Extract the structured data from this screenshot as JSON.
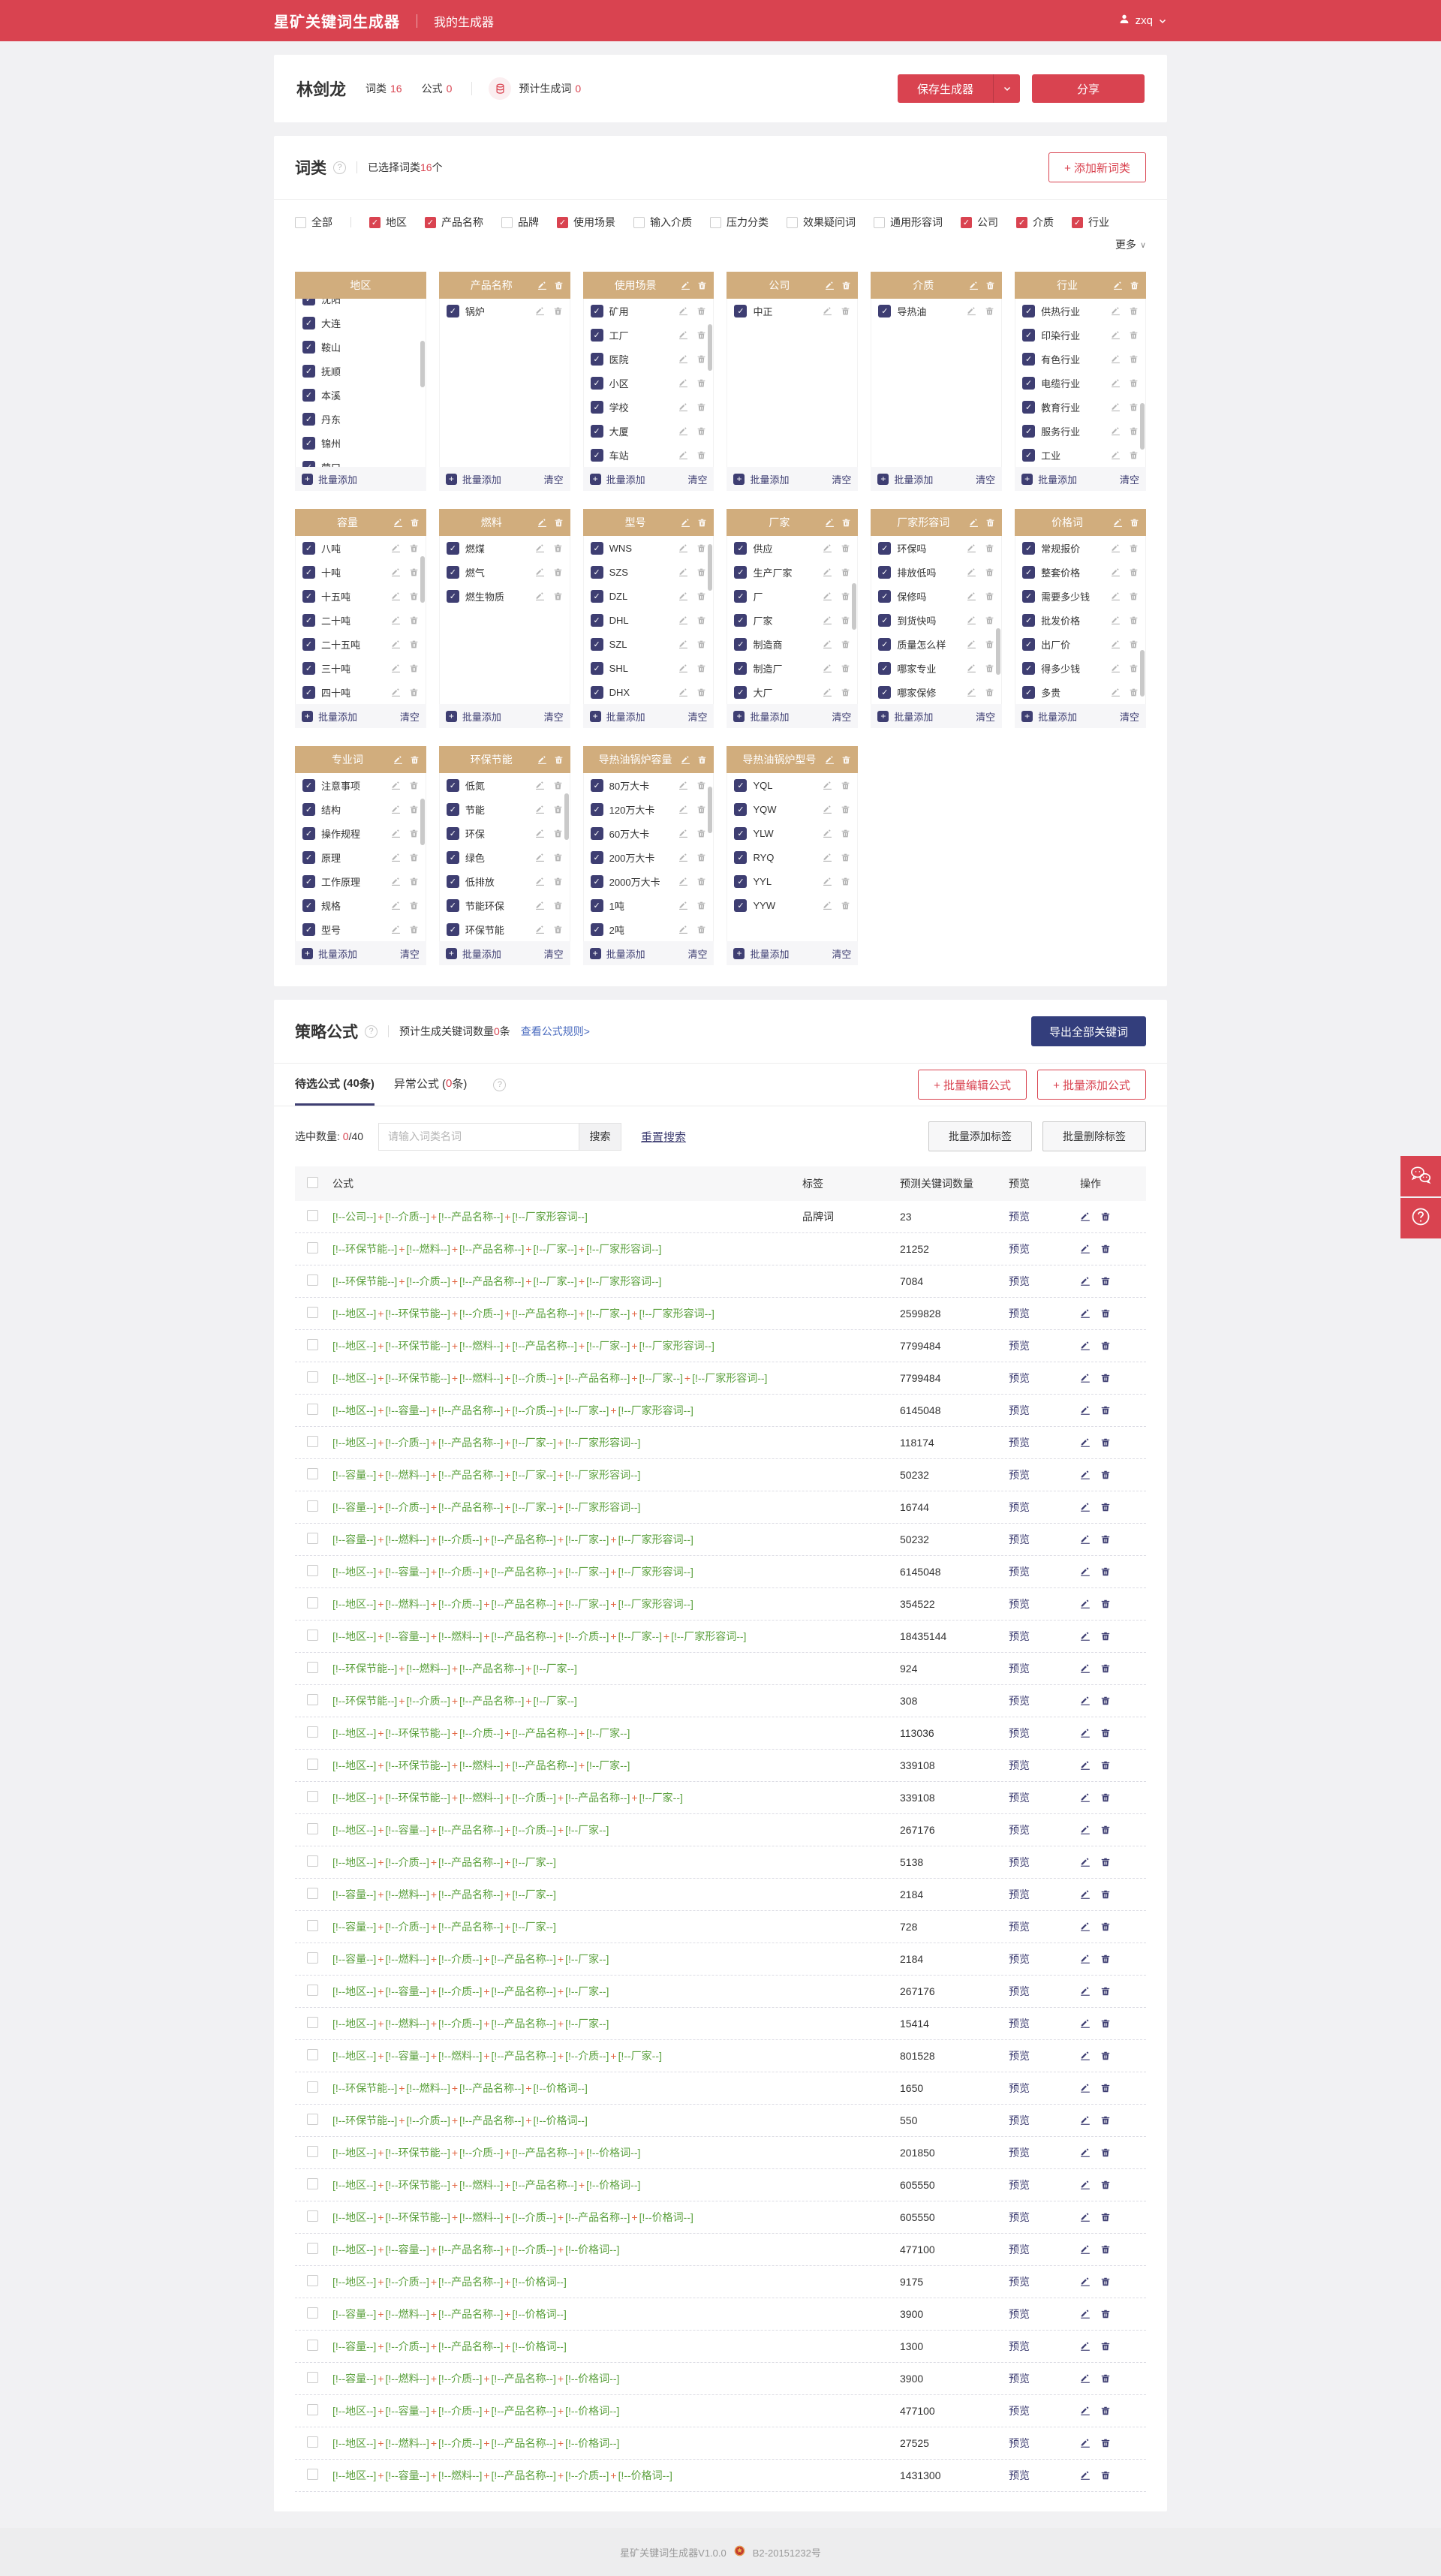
{
  "header": {
    "brand": "星矿关键词生成器",
    "nav": "我的生成器",
    "user": "zxq"
  },
  "summary": {
    "name": "林剑龙",
    "stat1_label": "词类",
    "stat1_value": "16",
    "stat2_label": "公式",
    "stat2_value": "0",
    "gen_label": "预计生成词",
    "gen_value": "0",
    "save_label": "保存生成器",
    "share_label": "分享"
  },
  "wordclass": {
    "title": "词类",
    "help": "?",
    "selected_pre": "已选择词类",
    "selected_num": "16",
    "selected_suf": "个",
    "add_new": "+ 添加新词类",
    "more": "更多",
    "filters": [
      {
        "label": "全部",
        "checked": false
      },
      {
        "label": "地区",
        "checked": true
      },
      {
        "label": "产品名称",
        "checked": true
      },
      {
        "label": "品牌",
        "checked": false
      },
      {
        "label": "使用场景",
        "checked": true
      },
      {
        "label": "输入介质",
        "checked": false
      },
      {
        "label": "压力分类",
        "checked": false
      },
      {
        "label": "效果疑问词",
        "checked": false
      },
      {
        "label": "通用形容词",
        "checked": false
      },
      {
        "label": "公司",
        "checked": true
      },
      {
        "label": "介质",
        "checked": true
      },
      {
        "label": "行业",
        "checked": true
      }
    ],
    "batch_add": "批量添加",
    "clear": "清空",
    "cards": [
      {
        "title": "地区",
        "items": [
          "沈阳",
          "大连",
          "鞍山",
          "抚顺",
          "本溪",
          "丹东",
          "锦州",
          "营口"
        ],
        "header_icons": false,
        "item_icons": false,
        "clear": false,
        "scrollbar": true,
        "thumb_top": 0.25,
        "scrolled": true
      },
      {
        "title": "产品名称",
        "items": [
          "锅炉"
        ],
        "header_icons": true,
        "item_icons": true,
        "clear": true,
        "scrollbar": false
      },
      {
        "title": "使用场景",
        "items": [
          "矿用",
          "工厂",
          "医院",
          "小区",
          "学校",
          "大厦",
          "车站"
        ],
        "header_icons": true,
        "item_icons": true,
        "clear": true,
        "scrollbar": true,
        "thumb_top": 0.15
      },
      {
        "title": "公司",
        "items": [
          "中正"
        ],
        "header_icons": true,
        "item_icons": true,
        "clear": true,
        "scrollbar": false
      },
      {
        "title": "介质",
        "items": [
          "导热油"
        ],
        "header_icons": true,
        "item_icons": true,
        "clear": true,
        "scrollbar": false
      },
      {
        "title": "行业",
        "items": [
          "供热行业",
          "印染行业",
          "有色行业",
          "电缆行业",
          "教育行业",
          "服务行业",
          "工业"
        ],
        "header_icons": true,
        "item_icons": true,
        "clear": true,
        "scrollbar": true,
        "thumb_top": 0.62
      },
      {
        "title": "容量",
        "items": [
          "八吨",
          "十吨",
          "十五吨",
          "二十吨",
          "二十五吨",
          "三十吨",
          "四十吨"
        ],
        "header_icons": true,
        "item_icons": true,
        "clear": true,
        "scrollbar": true,
        "thumb_top": 0.12
      },
      {
        "title": "燃料",
        "items": [
          "燃煤",
          "燃气",
          "燃生物质"
        ],
        "header_icons": true,
        "item_icons": true,
        "clear": true,
        "scrollbar": false
      },
      {
        "title": "型号",
        "items": [
          "WNS",
          "SZS",
          "DZL",
          "DHL",
          "SZL",
          "SHL",
          "DHX"
        ],
        "header_icons": true,
        "item_icons": true,
        "clear": true,
        "scrollbar": true,
        "thumb_top": 0.05
      },
      {
        "title": "厂家",
        "items": [
          "供应",
          "生产厂家",
          "厂",
          "厂家",
          "制造商",
          "制造厂",
          "大厂"
        ],
        "header_icons": true,
        "item_icons": true,
        "clear": true,
        "scrollbar": true,
        "thumb_top": 0.28
      },
      {
        "title": "厂家形容词",
        "items": [
          "环保吗",
          "排放低吗",
          "保修吗",
          "到货快吗",
          "质量怎么样",
          "哪家专业",
          "哪家保修"
        ],
        "header_icons": true,
        "item_icons": true,
        "clear": true,
        "scrollbar": true,
        "thumb_top": 0.55
      },
      {
        "title": "价格词",
        "items": [
          "常规报价",
          "整套价格",
          "需要多少钱",
          "批发价格",
          "出厂价",
          "得多少钱",
          "多贵"
        ],
        "header_icons": true,
        "item_icons": true,
        "clear": true,
        "scrollbar": true,
        "thumb_top": 0.68
      },
      {
        "title": "专业词",
        "items": [
          "注意事项",
          "结构",
          "操作规程",
          "原理",
          "工作原理",
          "规格",
          "型号"
        ],
        "header_icons": true,
        "item_icons": true,
        "clear": true,
        "scrollbar": true,
        "thumb_top": 0.15
      },
      {
        "title": "环保节能",
        "items": [
          "低氮",
          "节能",
          "环保",
          "绿色",
          "低排放",
          "节能环保",
          "环保节能"
        ],
        "header_icons": true,
        "item_icons": true,
        "clear": true,
        "scrollbar": true,
        "thumb_top": 0.12
      },
      {
        "title": "导热油锅炉容量",
        "items": [
          "80万大卡",
          "120万大卡",
          "60万大卡",
          "200万大卡",
          "2000万大卡",
          "1吨",
          "2吨"
        ],
        "header_icons": true,
        "item_icons": true,
        "clear": true,
        "scrollbar": true,
        "thumb_top": 0.08
      },
      {
        "title": "导热油锅炉型号",
        "items": [
          "YQL",
          "YQW",
          "YLW",
          "RYQ",
          "YYL",
          "YYW"
        ],
        "header_icons": true,
        "item_icons": true,
        "clear": true,
        "scrollbar": false
      }
    ]
  },
  "formula": {
    "title": "策略公式",
    "count_pre": "预计生成关键词数量",
    "count_num": "0",
    "count_suf": "条",
    "rules_link": "查看公式规则>",
    "export_btn": "导出全部关键词",
    "tab1_pre": "待选公式 (",
    "tab1_num": "40",
    "tab1_suf": "条)",
    "tab2_pre": "异常公式 (",
    "tab2_num": "0",
    "tab2_suf": "条)",
    "batch_edit": "+ 批量编辑公式",
    "batch_add": "+ 批量添加公式",
    "selected_label": "选中数量:",
    "selected_num": "0",
    "selected_total": "/40",
    "search_placeholder": "请输入词类名词",
    "search_btn": "搜索",
    "reset_btn": "重置搜索",
    "tag_add_btn": "批量添加标签",
    "tag_del_btn": "批量删除标签",
    "col_formula": "公式",
    "col_tag": "标签",
    "col_count": "预测关键词数量",
    "col_preview": "预览",
    "col_ops": "操作",
    "preview_label": "预览",
    "bracket_open": "[!--",
    "bracket_close": "--]",
    "joiner": "+",
    "rows": [
      {
        "parts": [
          "公司",
          "介质",
          "产品名称",
          "厂家形容词"
        ],
        "tag": "品牌词",
        "count": "23"
      },
      {
        "parts": [
          "环保节能",
          "燃料",
          "产品名称",
          "厂家",
          "厂家形容词"
        ],
        "tag": "",
        "count": "21252"
      },
      {
        "parts": [
          "环保节能",
          "介质",
          "产品名称",
          "厂家",
          "厂家形容词"
        ],
        "tag": "",
        "count": "7084"
      },
      {
        "parts": [
          "地区",
          "环保节能",
          "介质",
          "产品名称",
          "厂家",
          "厂家形容词"
        ],
        "tag": "",
        "count": "2599828"
      },
      {
        "parts": [
          "地区",
          "环保节能",
          "燃料",
          "产品名称",
          "厂家",
          "厂家形容词"
        ],
        "tag": "",
        "count": "7799484"
      },
      {
        "parts": [
          "地区",
          "环保节能",
          "燃料",
          "介质",
          "产品名称",
          "厂家",
          "厂家形容词"
        ],
        "tag": "",
        "count": "7799484"
      },
      {
        "parts": [
          "地区",
          "容量",
          "产品名称",
          "介质",
          "厂家",
          "厂家形容词"
        ],
        "tag": "",
        "count": "6145048"
      },
      {
        "parts": [
          "地区",
          "介质",
          "产品名称",
          "厂家",
          "厂家形容词"
        ],
        "tag": "",
        "count": "118174"
      },
      {
        "parts": [
          "容量",
          "燃料",
          "产品名称",
          "厂家",
          "厂家形容词"
        ],
        "tag": "",
        "count": "50232"
      },
      {
        "parts": [
          "容量",
          "介质",
          "产品名称",
          "厂家",
          "厂家形容词"
        ],
        "tag": "",
        "count": "16744"
      },
      {
        "parts": [
          "容量",
          "燃料",
          "介质",
          "产品名称",
          "厂家",
          "厂家形容词"
        ],
        "tag": "",
        "count": "50232"
      },
      {
        "parts": [
          "地区",
          "容量",
          "介质",
          "产品名称",
          "厂家",
          "厂家形容词"
        ],
        "tag": "",
        "count": "6145048"
      },
      {
        "parts": [
          "地区",
          "燃料",
          "介质",
          "产品名称",
          "厂家",
          "厂家形容词"
        ],
        "tag": "",
        "count": "354522"
      },
      {
        "parts": [
          "地区",
          "容量",
          "燃料",
          "产品名称",
          "介质",
          "厂家",
          "厂家形容词"
        ],
        "tag": "",
        "count": "18435144"
      },
      {
        "parts": [
          "环保节能",
          "燃料",
          "产品名称",
          "厂家"
        ],
        "tag": "",
        "count": "924"
      },
      {
        "parts": [
          "环保节能",
          "介质",
          "产品名称",
          "厂家"
        ],
        "tag": "",
        "count": "308"
      },
      {
        "parts": [
          "地区",
          "环保节能",
          "介质",
          "产品名称",
          "厂家"
        ],
        "tag": "",
        "count": "113036"
      },
      {
        "parts": [
          "地区",
          "环保节能",
          "燃料",
          "产品名称",
          "厂家"
        ],
        "tag": "",
        "count": "339108"
      },
      {
        "parts": [
          "地区",
          "环保节能",
          "燃料",
          "介质",
          "产品名称",
          "厂家"
        ],
        "tag": "",
        "count": "339108"
      },
      {
        "parts": [
          "地区",
          "容量",
          "产品名称",
          "介质",
          "厂家"
        ],
        "tag": "",
        "count": "267176"
      },
      {
        "parts": [
          "地区",
          "介质",
          "产品名称",
          "厂家"
        ],
        "tag": "",
        "count": "5138"
      },
      {
        "parts": [
          "容量",
          "燃料",
          "产品名称",
          "厂家"
        ],
        "tag": "",
        "count": "2184"
      },
      {
        "parts": [
          "容量",
          "介质",
          "产品名称",
          "厂家"
        ],
        "tag": "",
        "count": "728"
      },
      {
        "parts": [
          "容量",
          "燃料",
          "介质",
          "产品名称",
          "厂家"
        ],
        "tag": "",
        "count": "2184"
      },
      {
        "parts": [
          "地区",
          "容量",
          "介质",
          "产品名称",
          "厂家"
        ],
        "tag": "",
        "count": "267176"
      },
      {
        "parts": [
          "地区",
          "燃料",
          "介质",
          "产品名称",
          "厂家"
        ],
        "tag": "",
        "count": "15414"
      },
      {
        "parts": [
          "地区",
          "容量",
          "燃料",
          "产品名称",
          "介质",
          "厂家"
        ],
        "tag": "",
        "count": "801528"
      },
      {
        "parts": [
          "环保节能",
          "燃料",
          "产品名称",
          "价格词"
        ],
        "tag": "",
        "count": "1650"
      },
      {
        "parts": [
          "环保节能",
          "介质",
          "产品名称",
          "价格词"
        ],
        "tag": "",
        "count": "550"
      },
      {
        "parts": [
          "地区",
          "环保节能",
          "介质",
          "产品名称",
          "价格词"
        ],
        "tag": "",
        "count": "201850"
      },
      {
        "parts": [
          "地区",
          "环保节能",
          "燃料",
          "产品名称",
          "价格词"
        ],
        "tag": "",
        "count": "605550"
      },
      {
        "parts": [
          "地区",
          "环保节能",
          "燃料",
          "介质",
          "产品名称",
          "价格词"
        ],
        "tag": "",
        "count": "605550"
      },
      {
        "parts": [
          "地区",
          "容量",
          "产品名称",
          "介质",
          "价格词"
        ],
        "tag": "",
        "count": "477100"
      },
      {
        "parts": [
          "地区",
          "介质",
          "产品名称",
          "价格词"
        ],
        "tag": "",
        "count": "9175"
      },
      {
        "parts": [
          "容量",
          "燃料",
          "产品名称",
          "价格词"
        ],
        "tag": "",
        "count": "3900"
      },
      {
        "parts": [
          "容量",
          "介质",
          "产品名称",
          "价格词"
        ],
        "tag": "",
        "count": "1300"
      },
      {
        "parts": [
          "容量",
          "燃料",
          "介质",
          "产品名称",
          "价格词"
        ],
        "tag": "",
        "count": "3900"
      },
      {
        "parts": [
          "地区",
          "容量",
          "介质",
          "产品名称",
          "价格词"
        ],
        "tag": "",
        "count": "477100"
      },
      {
        "parts": [
          "地区",
          "燃料",
          "介质",
          "产品名称",
          "价格词"
        ],
        "tag": "",
        "count": "27525"
      },
      {
        "parts": [
          "地区",
          "容量",
          "燃料",
          "产品名称",
          "介质",
          "价格词"
        ],
        "tag": "",
        "count": "1431300"
      }
    ]
  },
  "footer": {
    "version": "星矿关键词生成器V1.0.0",
    "icp": "B2-20151232号"
  },
  "colors": {
    "brand_red": "#d94350",
    "tan": "#d1ad7d",
    "indigo": "#3e3e72",
    "formula_green": "#5aa03c",
    "plus_orange": "#e26542",
    "navy": "#333e7c",
    "link_blue": "#4a6bbf"
  }
}
